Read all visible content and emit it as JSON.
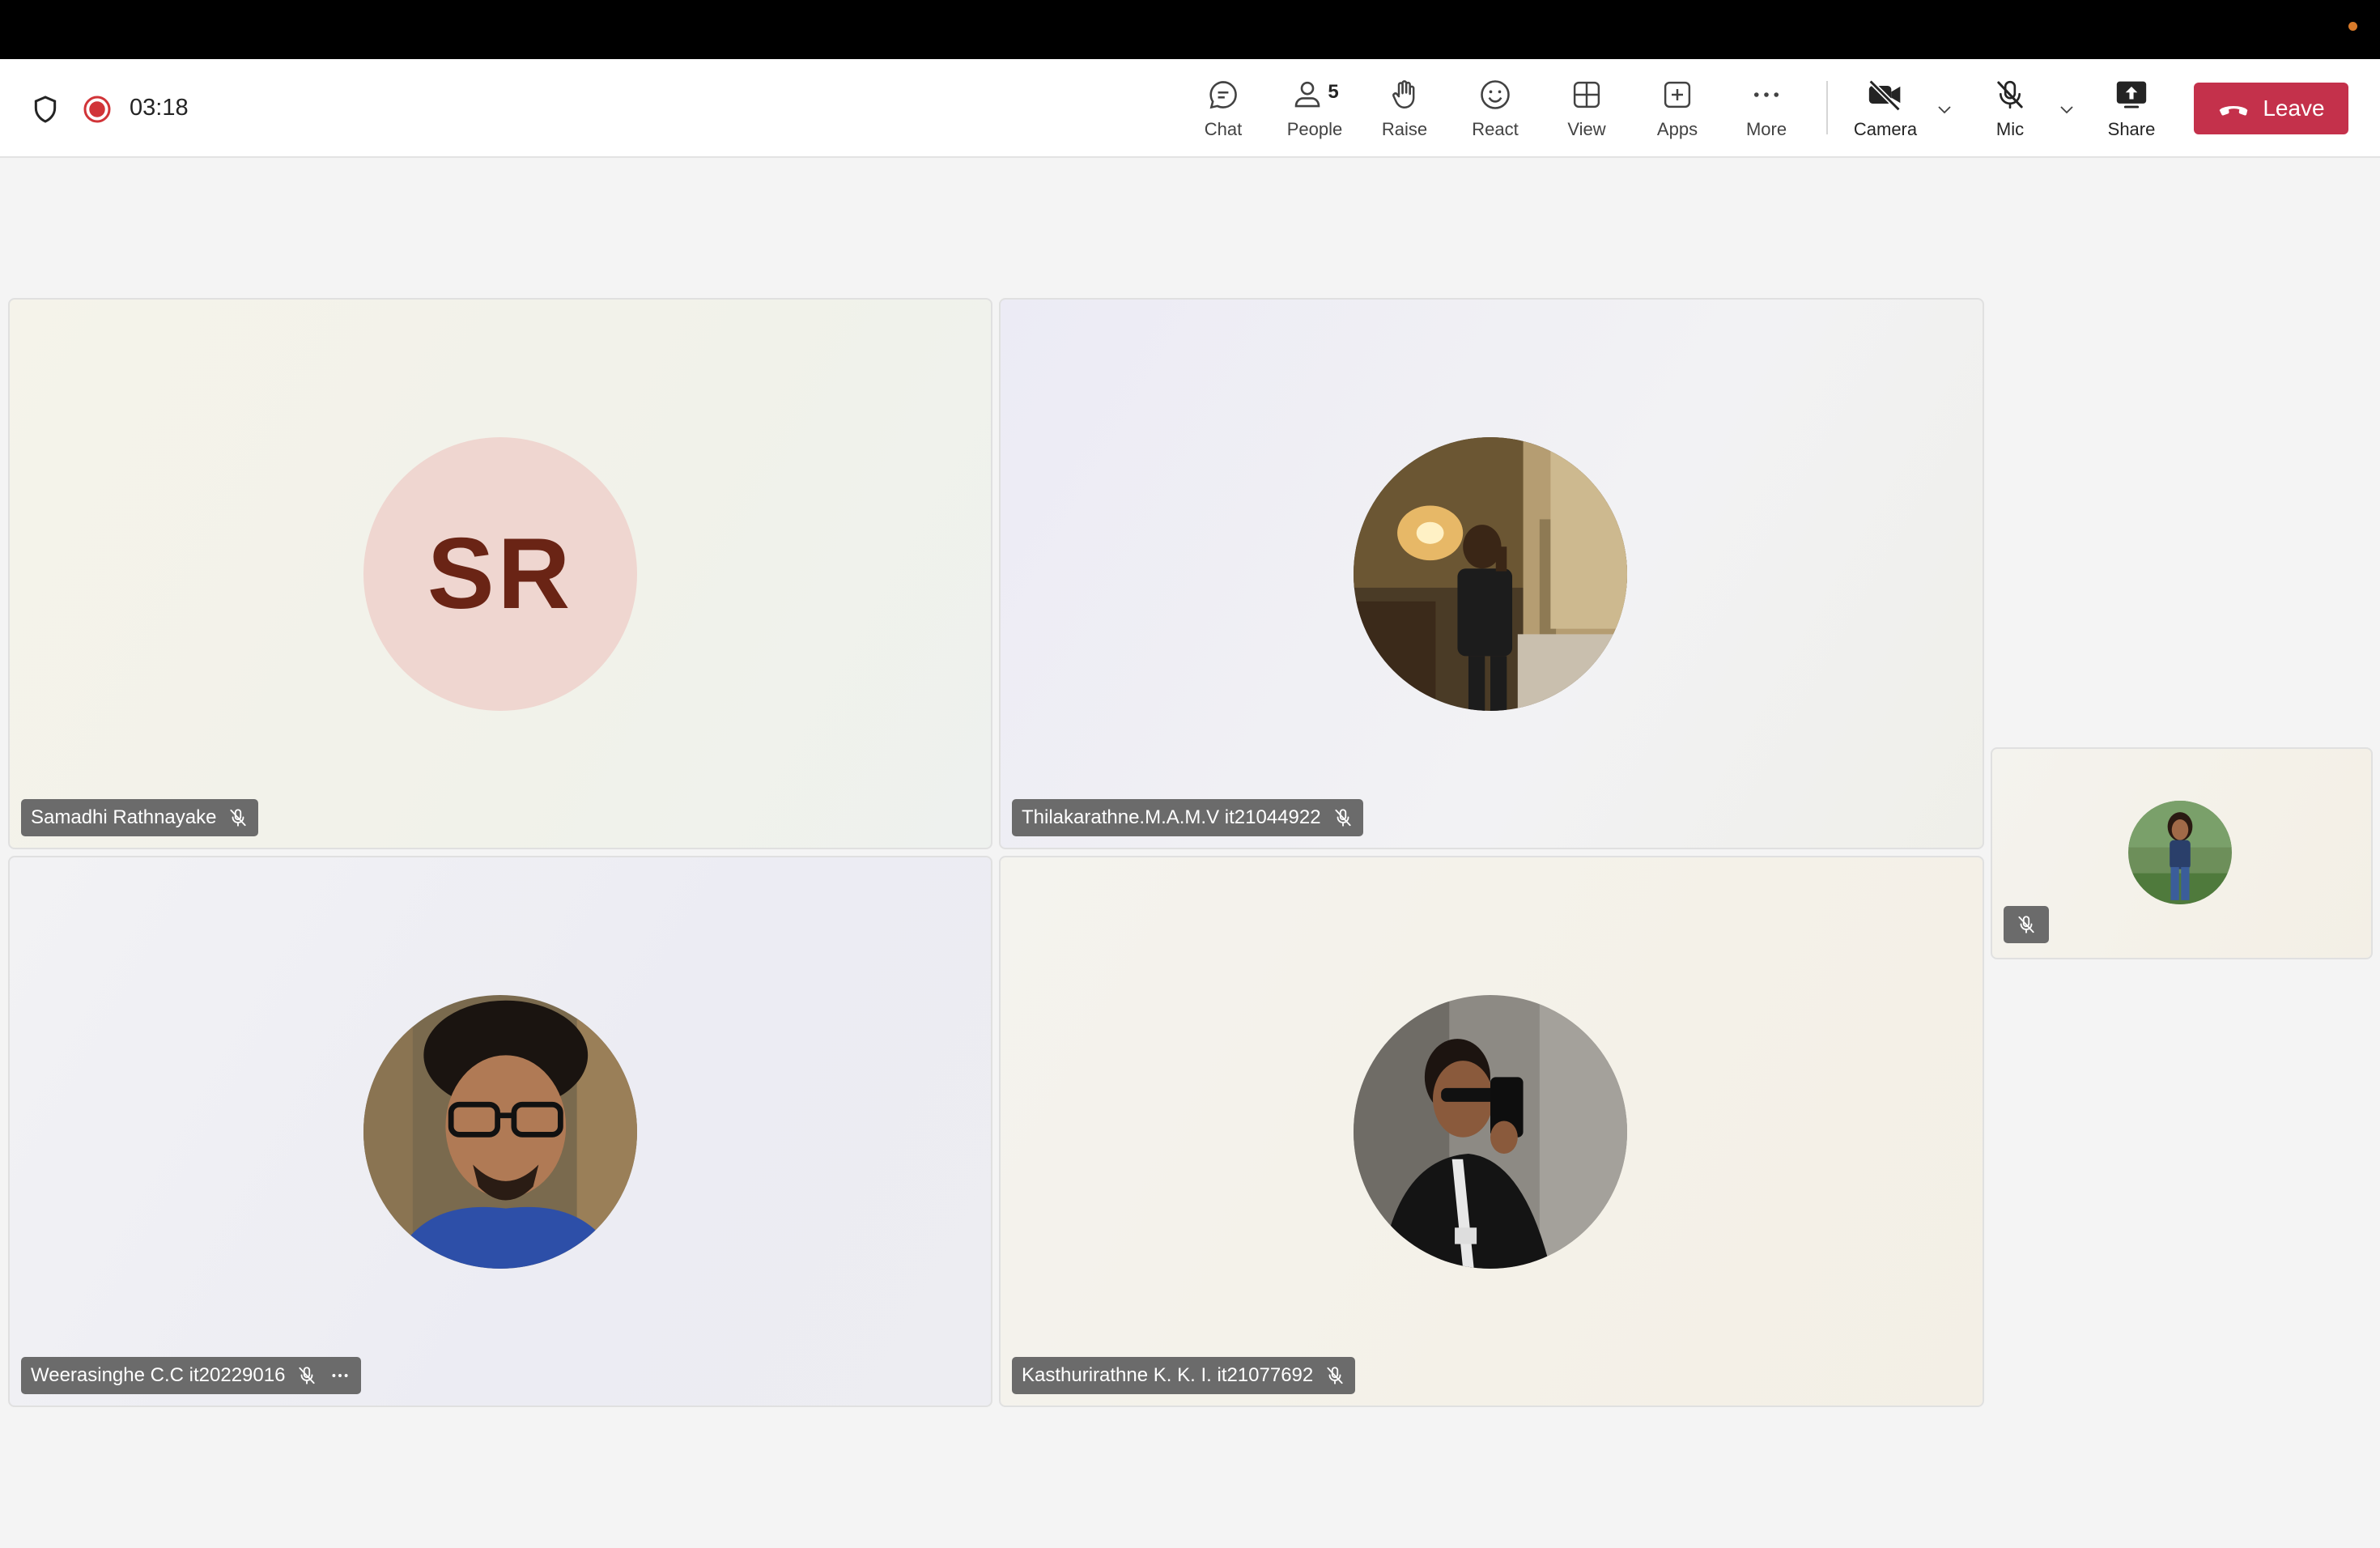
{
  "call": {
    "timer": "03:18",
    "people_count": "5"
  },
  "toolbar": {
    "chat": "Chat",
    "people": "People",
    "raise": "Raise",
    "react": "React",
    "view": "View",
    "apps": "Apps",
    "more": "More",
    "camera": "Camera",
    "mic": "Mic",
    "share": "Share",
    "leave": "Leave"
  },
  "participants": [
    {
      "name": "Samadhi Rathnayake",
      "initials": "SR",
      "muted": true
    },
    {
      "name": "Thilakarathne.M.A.M.V it21044922",
      "muted": true
    },
    {
      "name": "Weerasinghe C.C it20229016",
      "muted": true
    },
    {
      "name": "Kasthurirathne K. K. I. it21077692",
      "muted": true
    }
  ],
  "self_view": {
    "muted": true
  },
  "colors": {
    "leave_button": "#c4314b",
    "recording": "#d13438",
    "initials_bg": "#efd6d0",
    "initials_text": "#6a2415"
  },
  "icons": [
    "shield-icon",
    "record-icon",
    "chat-icon",
    "people-icon",
    "raise-hand-icon",
    "react-icon",
    "view-icon",
    "apps-icon",
    "more-icon",
    "camera-off-icon",
    "mic-off-icon",
    "share-icon",
    "phone-hangup-icon",
    "chevron-down-icon"
  ]
}
